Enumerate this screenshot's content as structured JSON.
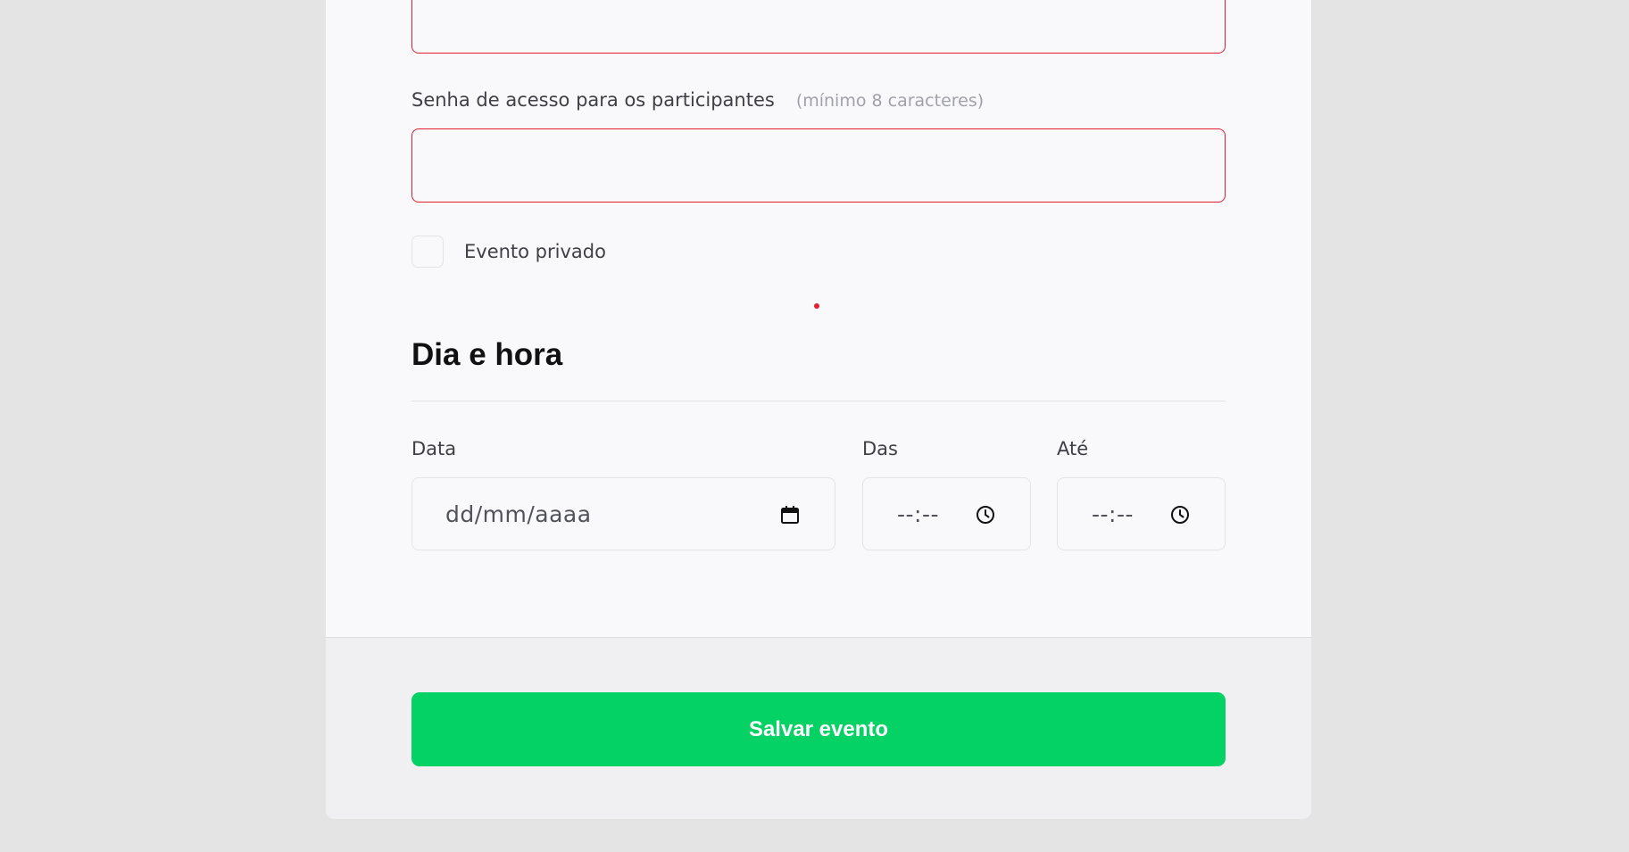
{
  "form": {
    "password_label": "Senha de acesso para os participantes",
    "password_hint": "(mínimo 8 caracteres)",
    "private_label": "Evento privado"
  },
  "section": {
    "title": "Dia e hora"
  },
  "date": {
    "label": "Data",
    "placeholder": "dd/mm/aaaa",
    "icon": "calendar-icon"
  },
  "start": {
    "label": "Das",
    "placeholder": "--:--",
    "icon": "clock-icon"
  },
  "end": {
    "label": "Até",
    "placeholder": "--:--",
    "icon": "clock-icon"
  },
  "footer": {
    "save_label": "Salvar evento"
  },
  "colors": {
    "error_border": "#e11d2e",
    "primary": "#05d264",
    "background": "#e4e4e4",
    "card": "#f9f9fb"
  }
}
